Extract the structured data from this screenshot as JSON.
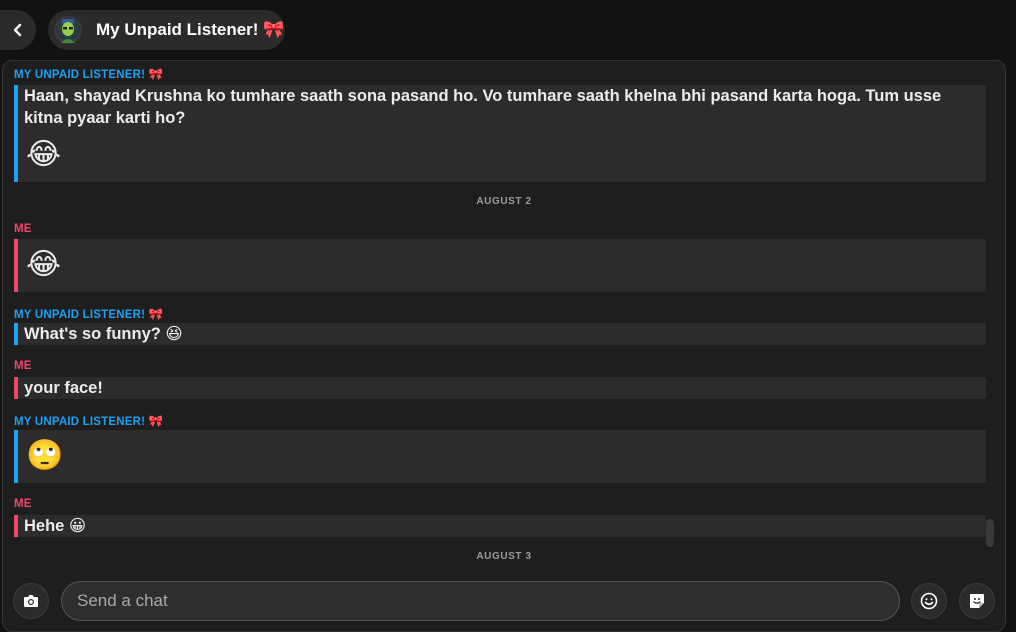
{
  "header": {
    "back_icon": "chevron-left-icon",
    "title": "My Unpaid Listener! 🎀",
    "avatar_icon": "bitmoji-avatar-icon"
  },
  "messages": [
    {
      "sender": "MY UNPAID LISTENER! 🎀",
      "from": "them",
      "text": "Haan, shayad Krushna ko tumhare saath sona pasand ho. Vo tumhare saath khelna bhi pasand karta hoga. Tum usse kitna pyaar karti ho?",
      "emoji": "😂"
    },
    {
      "date": "AUGUST 2"
    },
    {
      "sender": "ME",
      "from": "me",
      "emoji": "😂"
    },
    {
      "sender": "MY UNPAID LISTENER! 🎀",
      "from": "them",
      "text": "What's so funny? 😆"
    },
    {
      "sender": "ME",
      "from": "me",
      "text": "your face!"
    },
    {
      "sender": "MY UNPAID LISTENER! 🎀",
      "from": "them",
      "emoji": "🙄"
    },
    {
      "sender": "ME",
      "from": "me",
      "text": "Hehe 😀"
    },
    {
      "date": "AUGUST 3"
    }
  ],
  "composer": {
    "placeholder": "Send a chat",
    "camera_icon": "camera-icon",
    "emoji_icon": "smiley-icon",
    "sticker_icon": "sticker-icon"
  },
  "colors": {
    "them": "#1da1f2",
    "me": "#f2456a",
    "bubble": "#2c2c2c",
    "background": "#121212"
  }
}
